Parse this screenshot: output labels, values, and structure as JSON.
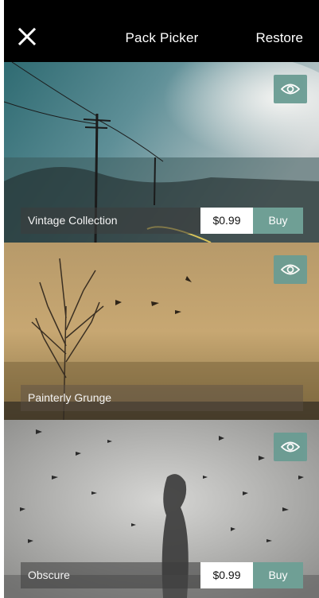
{
  "header": {
    "title": "Pack Picker",
    "restore_label": "Restore",
    "close_icon": "close-icon"
  },
  "packs": [
    {
      "name": "Vintage Collection",
      "price": "$0.99",
      "buy_label": "Buy",
      "preview_icon": "eye-icon"
    },
    {
      "name": "Painterly Grunge",
      "preview_icon": "eye-icon"
    },
    {
      "name": "Obscure",
      "price": "$0.99",
      "buy_label": "Buy",
      "preview_icon": "eye-icon"
    }
  ],
  "colors": {
    "accent": "#6f9f95",
    "header_bg": "#000000"
  }
}
